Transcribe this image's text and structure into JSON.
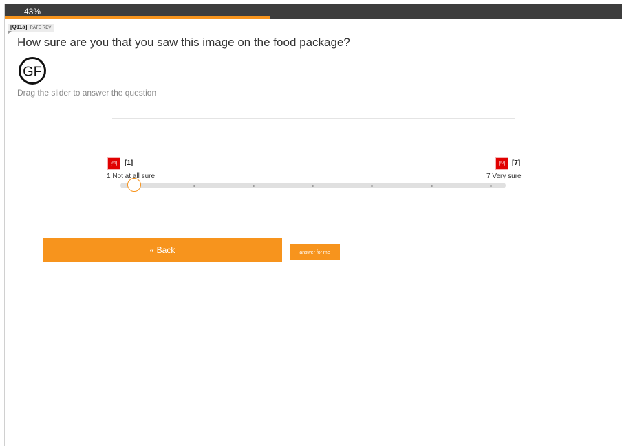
{
  "progress": {
    "text": "43%",
    "value_percent": 43
  },
  "question": {
    "id": "[Q11a]",
    "tag": "RATE REV",
    "text": "How sure are you that you saw this image on the food package?",
    "logo_text": "GF",
    "instruction": "Drag the slider to answer the question"
  },
  "slider": {
    "left": {
      "badge": "[c1]",
      "code": "[1]",
      "label": "1 Not at all sure"
    },
    "right": {
      "badge": "[c7]",
      "code": "[7]",
      "label": "7 Very sure"
    },
    "points": 7,
    "selected_value": 1
  },
  "buttons": {
    "back": "« Back",
    "answer_for_me": "answer for me"
  },
  "colors": {
    "accent": "#f7941d",
    "header": "#3d3d3d",
    "badge": "#e10000"
  }
}
